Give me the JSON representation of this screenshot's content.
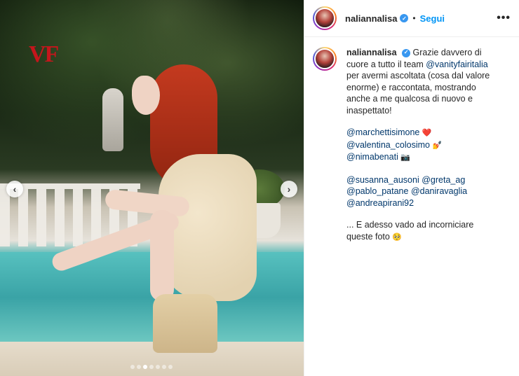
{
  "post": {
    "username": "naliannalisa",
    "follow_label": "Segui",
    "separator": "•",
    "more_label": "•••",
    "watermark": "VF",
    "carousel": {
      "total_slides": 7,
      "active_index": 2,
      "prev_icon": "chevron-left-icon",
      "next_icon": "chevron-right-icon"
    }
  },
  "caption": {
    "username": "naliannalisa",
    "p1_text_a": "Grazie davvero di cuore a tutto il team",
    "p1_mention": "@vanityfairitalia",
    "p1_text_b": "per avermi ascoltata (cosa dal valore enorme) e raccontata, mostrando anche a me qualcosa di nuovo e inaspettato!",
    "credits": [
      {
        "handle": "@marchettisimone",
        "emoji": "❤️"
      },
      {
        "handle": "@valentina_colosimo",
        "emoji": "💅"
      },
      {
        "handle": "@nimabenati",
        "emoji": "📷"
      }
    ],
    "tags": [
      "@susanna_ausoni",
      "@greta_ag",
      "@pablo_patane",
      "@daniravaglia",
      "@andreapirani92"
    ],
    "closing_text": "... E adesso vado ad incorniciare queste foto",
    "closing_emoji": "🥺"
  },
  "colors": {
    "link": "#00376b",
    "follow": "#0095f6",
    "verified": "#3897f0",
    "watermark": "#c4161c"
  }
}
